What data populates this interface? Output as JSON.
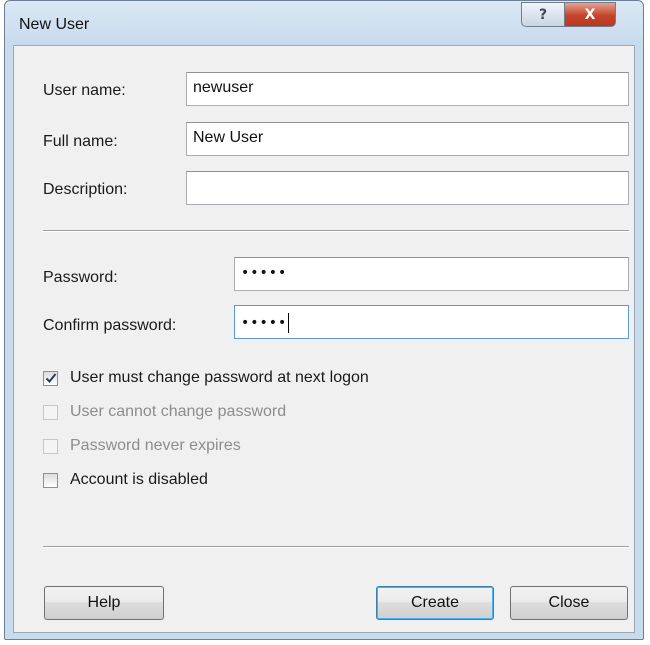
{
  "dialog": {
    "title": "New User",
    "help_icon": "question-mark-icon",
    "close_icon": "close-x-icon",
    "titlebar_help_glyph": "?",
    "titlebar_close_glyph": "X"
  },
  "form": {
    "username": {
      "label": "User name:",
      "value": "newuser"
    },
    "fullname": {
      "label": "Full name:",
      "value": "New User"
    },
    "description": {
      "label": "Description:",
      "value": ""
    },
    "password": {
      "label": "Password:",
      "value": "•••••"
    },
    "confirm_password": {
      "label": "Confirm password:",
      "value": "•••••"
    }
  },
  "options": [
    {
      "label": "User must change password at next logon",
      "checked": true,
      "enabled": true
    },
    {
      "label": "User cannot change password",
      "checked": false,
      "enabled": false
    },
    {
      "label": "Password never expires",
      "checked": false,
      "enabled": false
    },
    {
      "label": "Account is disabled",
      "checked": false,
      "enabled": true
    }
  ],
  "buttons": {
    "help": "Help",
    "create": "Create",
    "close": "Close"
  },
  "colors": {
    "window_frame": "#c9dcee",
    "client_bg": "#f0f0f0",
    "close_button": "#c4442b",
    "focus_border": "#5b9bd5",
    "default_button_border": "#3c7fb1"
  }
}
